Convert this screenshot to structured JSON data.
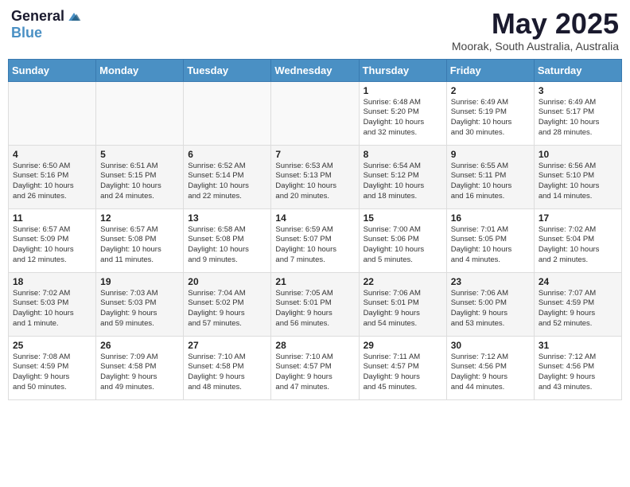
{
  "logo": {
    "general": "General",
    "blue": "Blue"
  },
  "title": "May 2025",
  "location": "Moorak, South Australia, Australia",
  "days_of_week": [
    "Sunday",
    "Monday",
    "Tuesday",
    "Wednesday",
    "Thursday",
    "Friday",
    "Saturday"
  ],
  "weeks": [
    [
      {
        "day": "",
        "info": ""
      },
      {
        "day": "",
        "info": ""
      },
      {
        "day": "",
        "info": ""
      },
      {
        "day": "",
        "info": ""
      },
      {
        "day": "1",
        "info": "Sunrise: 6:48 AM\nSunset: 5:20 PM\nDaylight: 10 hours\nand 32 minutes."
      },
      {
        "day": "2",
        "info": "Sunrise: 6:49 AM\nSunset: 5:19 PM\nDaylight: 10 hours\nand 30 minutes."
      },
      {
        "day": "3",
        "info": "Sunrise: 6:49 AM\nSunset: 5:17 PM\nDaylight: 10 hours\nand 28 minutes."
      }
    ],
    [
      {
        "day": "4",
        "info": "Sunrise: 6:50 AM\nSunset: 5:16 PM\nDaylight: 10 hours\nand 26 minutes."
      },
      {
        "day": "5",
        "info": "Sunrise: 6:51 AM\nSunset: 5:15 PM\nDaylight: 10 hours\nand 24 minutes."
      },
      {
        "day": "6",
        "info": "Sunrise: 6:52 AM\nSunset: 5:14 PM\nDaylight: 10 hours\nand 22 minutes."
      },
      {
        "day": "7",
        "info": "Sunrise: 6:53 AM\nSunset: 5:13 PM\nDaylight: 10 hours\nand 20 minutes."
      },
      {
        "day": "8",
        "info": "Sunrise: 6:54 AM\nSunset: 5:12 PM\nDaylight: 10 hours\nand 18 minutes."
      },
      {
        "day": "9",
        "info": "Sunrise: 6:55 AM\nSunset: 5:11 PM\nDaylight: 10 hours\nand 16 minutes."
      },
      {
        "day": "10",
        "info": "Sunrise: 6:56 AM\nSunset: 5:10 PM\nDaylight: 10 hours\nand 14 minutes."
      }
    ],
    [
      {
        "day": "11",
        "info": "Sunrise: 6:57 AM\nSunset: 5:09 PM\nDaylight: 10 hours\nand 12 minutes."
      },
      {
        "day": "12",
        "info": "Sunrise: 6:57 AM\nSunset: 5:08 PM\nDaylight: 10 hours\nand 11 minutes."
      },
      {
        "day": "13",
        "info": "Sunrise: 6:58 AM\nSunset: 5:08 PM\nDaylight: 10 hours\nand 9 minutes."
      },
      {
        "day": "14",
        "info": "Sunrise: 6:59 AM\nSunset: 5:07 PM\nDaylight: 10 hours\nand 7 minutes."
      },
      {
        "day": "15",
        "info": "Sunrise: 7:00 AM\nSunset: 5:06 PM\nDaylight: 10 hours\nand 5 minutes."
      },
      {
        "day": "16",
        "info": "Sunrise: 7:01 AM\nSunset: 5:05 PM\nDaylight: 10 hours\nand 4 minutes."
      },
      {
        "day": "17",
        "info": "Sunrise: 7:02 AM\nSunset: 5:04 PM\nDaylight: 10 hours\nand 2 minutes."
      }
    ],
    [
      {
        "day": "18",
        "info": "Sunrise: 7:02 AM\nSunset: 5:03 PM\nDaylight: 10 hours\nand 1 minute."
      },
      {
        "day": "19",
        "info": "Sunrise: 7:03 AM\nSunset: 5:03 PM\nDaylight: 9 hours\nand 59 minutes."
      },
      {
        "day": "20",
        "info": "Sunrise: 7:04 AM\nSunset: 5:02 PM\nDaylight: 9 hours\nand 57 minutes."
      },
      {
        "day": "21",
        "info": "Sunrise: 7:05 AM\nSunset: 5:01 PM\nDaylight: 9 hours\nand 56 minutes."
      },
      {
        "day": "22",
        "info": "Sunrise: 7:06 AM\nSunset: 5:01 PM\nDaylight: 9 hours\nand 54 minutes."
      },
      {
        "day": "23",
        "info": "Sunrise: 7:06 AM\nSunset: 5:00 PM\nDaylight: 9 hours\nand 53 minutes."
      },
      {
        "day": "24",
        "info": "Sunrise: 7:07 AM\nSunset: 4:59 PM\nDaylight: 9 hours\nand 52 minutes."
      }
    ],
    [
      {
        "day": "25",
        "info": "Sunrise: 7:08 AM\nSunset: 4:59 PM\nDaylight: 9 hours\nand 50 minutes."
      },
      {
        "day": "26",
        "info": "Sunrise: 7:09 AM\nSunset: 4:58 PM\nDaylight: 9 hours\nand 49 minutes."
      },
      {
        "day": "27",
        "info": "Sunrise: 7:10 AM\nSunset: 4:58 PM\nDaylight: 9 hours\nand 48 minutes."
      },
      {
        "day": "28",
        "info": "Sunrise: 7:10 AM\nSunset: 4:57 PM\nDaylight: 9 hours\nand 47 minutes."
      },
      {
        "day": "29",
        "info": "Sunrise: 7:11 AM\nSunset: 4:57 PM\nDaylight: 9 hours\nand 45 minutes."
      },
      {
        "day": "30",
        "info": "Sunrise: 7:12 AM\nSunset: 4:56 PM\nDaylight: 9 hours\nand 44 minutes."
      },
      {
        "day": "31",
        "info": "Sunrise: 7:12 AM\nSunset: 4:56 PM\nDaylight: 9 hours\nand 43 minutes."
      }
    ]
  ]
}
